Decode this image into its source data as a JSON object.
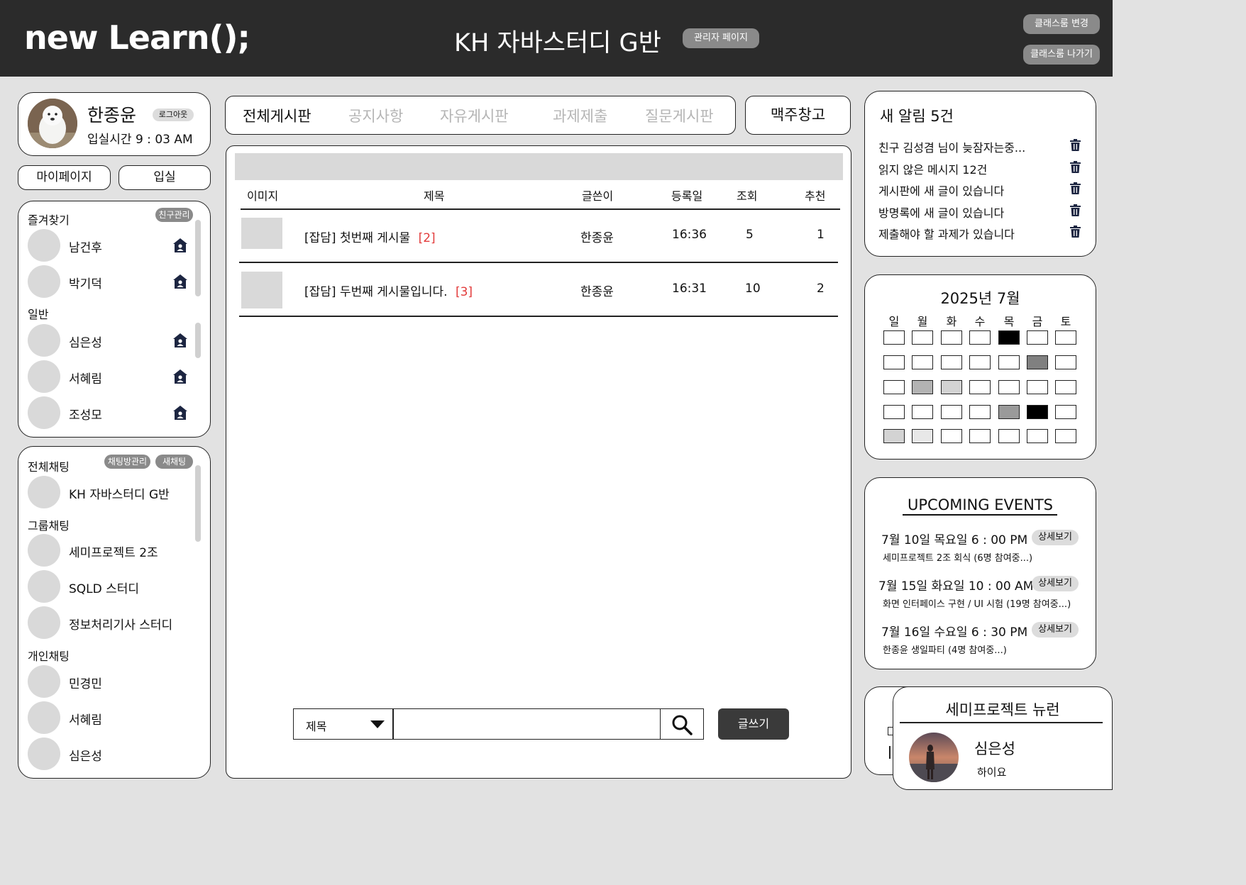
{
  "header": {
    "logo": "new Learn();",
    "class_title": "KH 자바스터디 G반",
    "admin_label": "관리자 페이지",
    "change_class_label": "클래스룸 변경",
    "leave_class_label": "클래스룸 나가기"
  },
  "profile": {
    "name": "한종윤",
    "logout_label": "로그아웃",
    "entry_time": "입실시간 9 : 03 AM",
    "mypage_label": "마이페이지",
    "enter_label": "입실"
  },
  "friends": {
    "favorites_title": "즐겨찾기",
    "manage_label": "친구관리",
    "favorites": [
      "남건후",
      "박기덕"
    ],
    "general_title": "일반",
    "general": [
      "심은성",
      "서혜림",
      "조성모"
    ]
  },
  "chat": {
    "all_title": "전체채팅",
    "manage_label": "채팅방관리",
    "new_label": "새채팅",
    "all": [
      "KH 자바스터디 G반"
    ],
    "group_title": "그룹채팅",
    "group": [
      "세미프로젝트 2조",
      "SQLD 스터디",
      "정보처리기사 스터디"
    ],
    "personal_title": "개인채팅",
    "personal": [
      "민경민",
      "서혜림",
      "심은성"
    ]
  },
  "tabs": {
    "items": [
      "전체게시판",
      "공지사항",
      "자유게시판",
      "과제제출",
      "질문게시판"
    ],
    "active": "전체게시판",
    "extra": "맥주창고"
  },
  "board": {
    "columns": [
      "이미지",
      "제목",
      "글쓴이",
      "등록일",
      "조회",
      "추천"
    ],
    "rows": [
      {
        "title": "[잡담] 첫번째 게시물",
        "comments": "[2]",
        "author": "한종윤",
        "date": "16:36",
        "views": "5",
        "likes": "1"
      },
      {
        "title": "[잡담] 두번째 게시물입니다.",
        "comments": "[3]",
        "author": "한종윤",
        "date": "16:31",
        "views": "10",
        "likes": "2"
      }
    ],
    "search_option": "제목",
    "search_value": "",
    "write_label": "글쓰기"
  },
  "notifications": {
    "title": "새 알림 5건",
    "items": [
      "친구 김성겸 님이 늦잠자는중...",
      "읽지 않은 메시지 12건",
      "게시판에 새 글이 있습니다",
      "방명록에 새 글이 있습니다",
      "제출해야 할 과제가 있습니다"
    ]
  },
  "calendar": {
    "title": "2025년 7월",
    "weekdays": [
      "일",
      "월",
      "화",
      "수",
      "목",
      "금",
      "토"
    ],
    "cell_colors": [
      [
        "#ffffff",
        "#ffffff",
        "#ffffff",
        "#ffffff",
        "#000000",
        "#ffffff",
        "#ffffff"
      ],
      [
        "#ffffff",
        "#ffffff",
        "#ffffff",
        "#ffffff",
        "#ffffff",
        "#808080",
        "#ffffff"
      ],
      [
        "#ffffff",
        "#b3b3b3",
        "#d3d3d3",
        "#ffffff",
        "#ffffff",
        "#ffffff",
        "#ffffff"
      ],
      [
        "#ffffff",
        "#ffffff",
        "#ffffff",
        "#ffffff",
        "#9a9a9a",
        "#000000",
        "#ffffff"
      ],
      [
        "#d3d3d3",
        "#e8e8e8",
        "#ffffff",
        "#ffffff",
        "#ffffff",
        "#ffffff",
        "#ffffff"
      ]
    ]
  },
  "events": {
    "title": "UPCOMING EVENTS",
    "detail_label": "상세보기",
    "items": [
      {
        "when": "7월 10일 목요일 6 : 00 PM",
        "desc": "세미프로젝트 2조 회식 (6명 참여중...)"
      },
      {
        "when": "7월 15일 화요일 10 : 00 AM",
        "desc": "화면 인터페이스 구현 / UI 시험 (19명 참여중...)"
      },
      {
        "when": "7월 16일 수요일 6 : 30 PM",
        "desc": "한종윤 생일파티 (4명 참여중...)"
      }
    ]
  },
  "chat_popup": {
    "title": "세미프로젝트 뉴런",
    "sender": "심은성",
    "message": "하이요"
  },
  "colors": {
    "header_bg": "#2b2b2b",
    "page_bg": "#e2e2e2",
    "comment_count": "#e23b3b",
    "icon_navy": "#1c2541"
  }
}
